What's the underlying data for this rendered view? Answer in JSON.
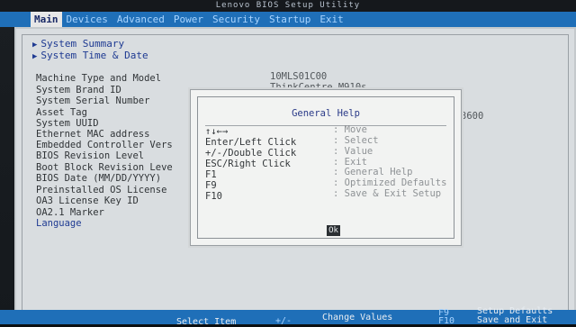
{
  "title_bar": "Lenovo BIOS Setup Utility",
  "menu": [
    "Main",
    "Devices",
    "Advanced",
    "Power",
    "Security",
    "Startup",
    "Exit"
  ],
  "nav_links": [
    "System Summary",
    "System Time & Date"
  ],
  "info_rows": [
    {
      "label": "Machine Type and Model",
      "value": "10MLS01C00"
    },
    {
      "label": "System Brand ID",
      "value": "ThinkCentre M910s"
    },
    {
      "label": "System Serial Number",
      "value": ""
    },
    {
      "label": "Asset Tag",
      "value": ""
    },
    {
      "label": "System UUID",
      "value": "3600"
    },
    {
      "label": "Ethernet MAC address",
      "value": ""
    },
    {
      "label": "Embedded Controller Vers",
      "value": ""
    },
    {
      "label": "BIOS Revision Level",
      "value": ""
    },
    {
      "label": "Boot Block Revision Leve",
      "value": ""
    },
    {
      "label": "BIOS Date (MM/DD/YYYY)",
      "value": ""
    },
    {
      "label": "Preinstalled OS License",
      "value": ""
    },
    {
      "label": "OA3 License Key ID",
      "value": ""
    },
    {
      "label": "OA2.1 Marker",
      "value": ""
    },
    {
      "label": "Language",
      "value": ""
    }
  ],
  "dialog": {
    "title": "General Help",
    "rows": [
      {
        "key": "↑↓←→",
        "action": ": Move"
      },
      {
        "key": "Enter/Left Click",
        "action": ": Select"
      },
      {
        "key": "+/-/Double Click",
        "action": ": Value"
      },
      {
        "key": "ESC/Right Click",
        "action": ": Exit"
      },
      {
        "key": "F1",
        "action": ": General Help"
      },
      {
        "key": "F9",
        "action": ": Optimized Defaults"
      },
      {
        "key": "F10",
        "action": ": Save & Exit Setup"
      }
    ],
    "ok_label": "Ok"
  },
  "bottom_bar": {
    "select_item": "Select Item",
    "plus_minus": "+/-",
    "change_values": "Change Values",
    "f9": "F9",
    "setup_defaults": "Setup Defaults",
    "f10": "F10",
    "save_exit": "Save and Exit"
  }
}
